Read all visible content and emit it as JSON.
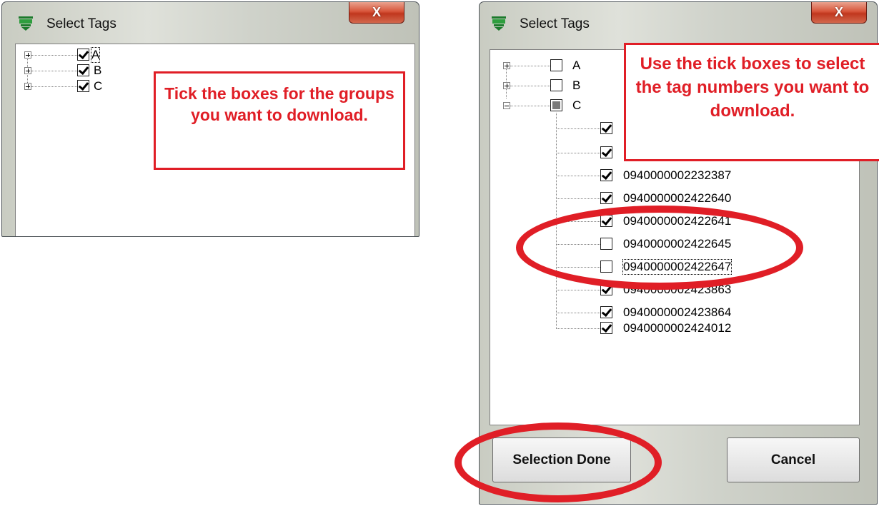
{
  "colors": {
    "annotation_red": "#e01e26",
    "title_bg": "#d6d8d1",
    "close_red": "#c8442a"
  },
  "icons": {
    "app": "green-tag-icon",
    "close": "close-icon",
    "expand": "plus-box-icon",
    "collapse": "minus-box-icon"
  },
  "window1": {
    "title": "Select Tags",
    "close_label": "X",
    "groups": [
      {
        "label": "A",
        "checked": true,
        "focused": true
      },
      {
        "label": "B",
        "checked": true
      },
      {
        "label": "C",
        "checked": true
      }
    ],
    "callout": "Tick the boxes for the groups you want to download."
  },
  "window2": {
    "title": "Select Tags",
    "close_label": "X",
    "groups": [
      {
        "label": "A",
        "state": "unchecked"
      },
      {
        "label": "B",
        "state": "unchecked"
      },
      {
        "label": "C",
        "state": "partial"
      }
    ],
    "tags": [
      {
        "label": "",
        "checked": true
      },
      {
        "label": "",
        "checked": true
      },
      {
        "label": "0940000002232387",
        "checked": true
      },
      {
        "label": "0940000002422640",
        "checked": true
      },
      {
        "label": "0940000002422641",
        "checked": true
      },
      {
        "label": "0940000002422645",
        "checked": false
      },
      {
        "label": "0940000002422647",
        "checked": false,
        "focused": true
      },
      {
        "label": "0940000002423863",
        "checked": true
      },
      {
        "label": "0940000002423864",
        "checked": true
      },
      {
        "label": "0940000002424012",
        "checked": true
      }
    ],
    "callout": "Use the tick boxes to select the tag numbers you want to download.",
    "selection_done_label": "Selection Done",
    "cancel_label": "Cancel"
  }
}
